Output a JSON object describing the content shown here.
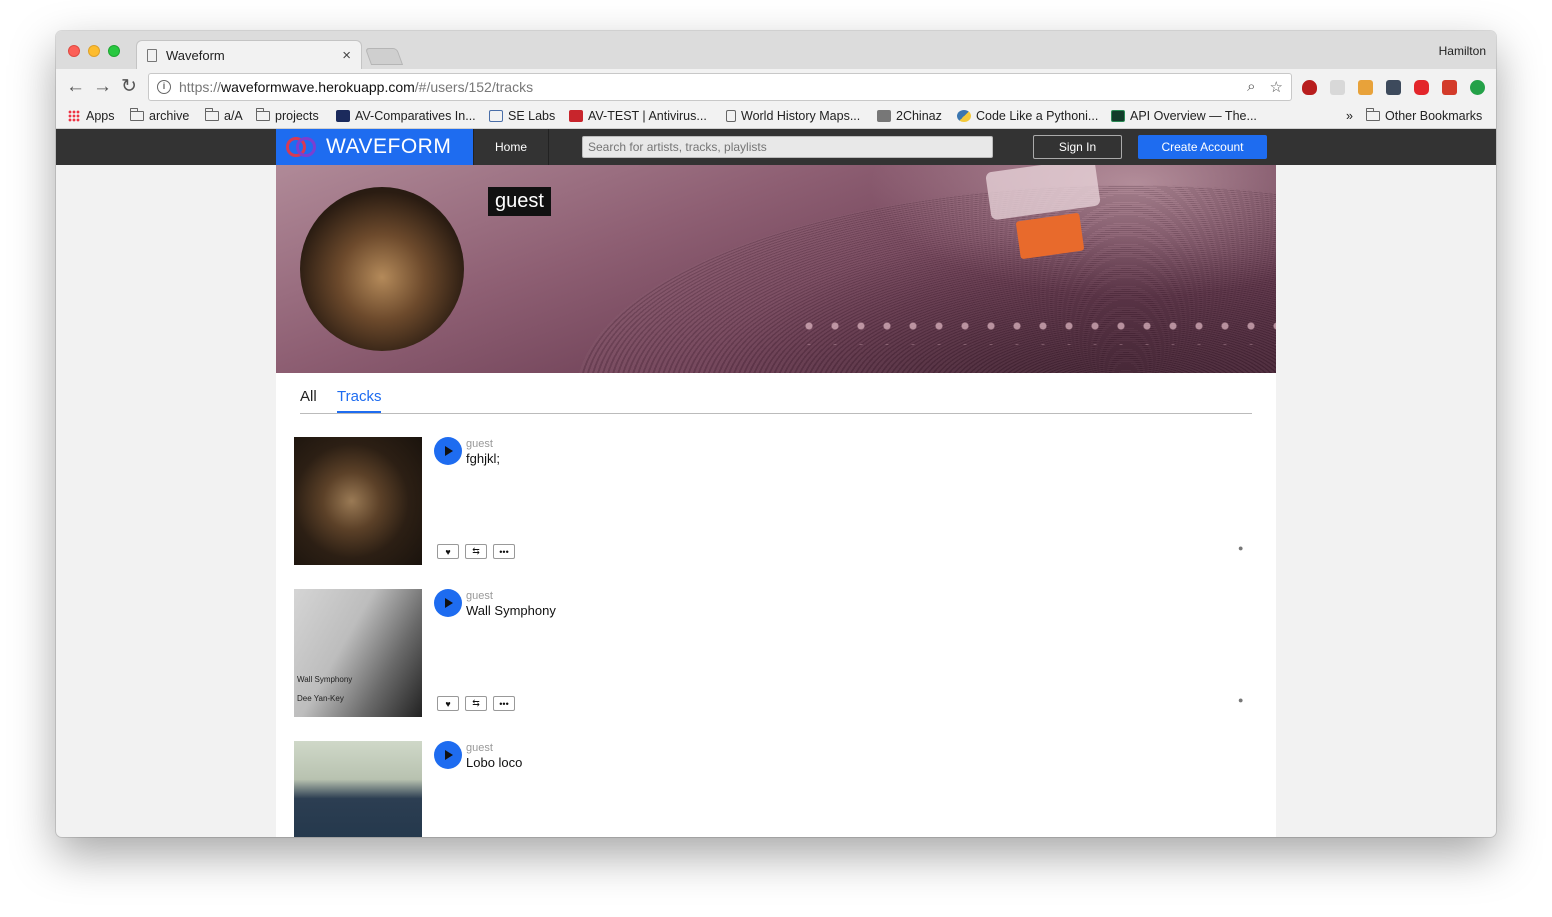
{
  "browser": {
    "tab_title": "Waveform",
    "tab_close": "×",
    "profile_name": "Hamilton",
    "url_scheme": "https://",
    "url_host": "waveformwave.herokuapp.com",
    "url_path": "/#/users/152/tracks",
    "nav_back": "←",
    "nav_forward": "→",
    "nav_reload": "↻",
    "zoom_icon": "⌕",
    "star_icon": "☆",
    "bookmarks": [
      {
        "label": "Apps",
        "icon": "apps-grid-icon"
      },
      {
        "label": "archive",
        "icon": "folder-icon"
      },
      {
        "label": "a/A",
        "icon": "folder-icon"
      },
      {
        "label": "projects",
        "icon": "folder-icon"
      },
      {
        "label": "AV-Comparatives In...",
        "icon": "av-comparatives-icon"
      },
      {
        "label": "SE Labs",
        "icon": "se-labs-icon"
      },
      {
        "label": "AV-TEST | Antivirus...",
        "icon": "av-test-icon"
      },
      {
        "label": "World History Maps...",
        "icon": "page-icon"
      },
      {
        "label": "2Chinaz",
        "icon": "site-icon"
      },
      {
        "label": "Code Like a Pythoni...",
        "icon": "python-icon"
      },
      {
        "label": "API Overview — The...",
        "icon": "api-icon"
      }
    ],
    "bookmarks_overflow": "»",
    "other_bookmarks": "Other Bookmarks"
  },
  "site": {
    "logo_text": "WAVEFORM",
    "home": "Home",
    "search_placeholder": "Search for artists, tracks, playlists",
    "sign_in": "Sign In",
    "create_account": "Create Account",
    "accent_color": "#1e6cf0"
  },
  "profile": {
    "username": "guest"
  },
  "tabs": {
    "all": "All",
    "tracks": "Tracks",
    "active": "Tracks"
  },
  "tracks": [
    {
      "artist": "guest",
      "title": "fghjkl;"
    },
    {
      "artist": "guest",
      "title": "Wall Symphony",
      "cover_caption_1": "Wall Symphony",
      "cover_caption_2": "Dee Yan-Key"
    },
    {
      "artist": "guest",
      "title": "Lobo loco"
    }
  ],
  "track_actions": {
    "like": "♥",
    "repost": "⇆",
    "more": "•••",
    "comment": "●"
  }
}
